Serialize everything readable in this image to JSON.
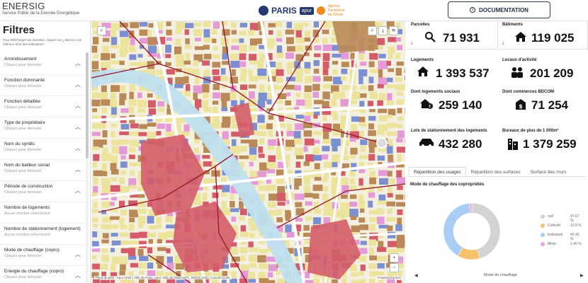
{
  "header": {
    "title": "ENERSIG",
    "subtitle": "Service Public de la Donnée Energétique",
    "paris_logo": "PARIS",
    "apur_logo": "apur",
    "agence_logo": "Agence Parisienne du Climat",
    "doc_button": "DOCUMENTATION",
    "doc_icon": "info-icon"
  },
  "sidebar": {
    "title": "Filtres",
    "help_text": "Pour télécharger les données, cliquez sur ⤓ dans le coin inférieur droit des indicateurs",
    "items": [
      {
        "label": "Arrondissement",
        "hint": "Cliquez pour dérouler"
      },
      {
        "label": "Fonction dominante",
        "hint": "Cliquez pour dérouler"
      },
      {
        "label": "Fonction détaillée",
        "hint": "Cliquez pour dérouler"
      },
      {
        "label": "Type de propriétaire",
        "hint": "Cliquez pour dérouler"
      },
      {
        "label": "Nom du syndic",
        "hint": "Cliquez pour dérouler"
      },
      {
        "label": "Nom du bailleur social",
        "hint": "Cliquez pour dérouler"
      },
      {
        "label": "Période de construction",
        "hint": "Cliquez pour dérouler"
      },
      {
        "label": "Nombre de logements",
        "hint": "Aucun nombre sélectionné"
      },
      {
        "label": "Nombre de stationnement (logement)",
        "hint": "Aucun nombre sélectionné"
      },
      {
        "label": "Mode de chauffage (copro)",
        "hint": "Cliquez pour dérouler"
      },
      {
        "label": "Energie du chauffage (copro)",
        "hint": "Cliquez pour dérouler"
      }
    ]
  },
  "map": {
    "credit_left": "Fond de plan : Apur 2018 | Ville de Paris, Apur, Ville de Paris, APC, DGFIP, ENC, CouchCounts",
    "credit_right": "Powered by Esri",
    "colors": {
      "base": "#f4f0df",
      "residential": "#ece39c",
      "office": "#b98a57",
      "public": "#d45c6a",
      "water": "#bfe0ef",
      "road": "#ffffff",
      "boundary": "#9b1c33",
      "blue": "#7b8fd1",
      "pink": "#e59ad8"
    }
  },
  "kpis": {
    "parcelles": {
      "label": "Parcelles",
      "value": "71 931",
      "icon": "search-icon"
    },
    "batiments": {
      "label": "Bâtiments",
      "value": "119 025",
      "icon": "house-icon"
    },
    "logements": {
      "label": "Logements",
      "value": "1 393 537",
      "icon": "home-icon"
    },
    "locaux": {
      "label": "Locaux d'activité",
      "value": "201 209",
      "icon": "people-icon"
    },
    "sociaux": {
      "label": "Dont logements sociaux",
      "value": "259 140",
      "icon": "social-housing-icon"
    },
    "commerces": {
      "label": "Dont commerces BDCOM",
      "value": "71 254",
      "icon": "shop-icon"
    },
    "stationnement": {
      "label": "Lots de stationnement des logements",
      "value": "432 280",
      "icon": "car-icon"
    },
    "bureaux": {
      "label": "Bureaux de plus de 1 000m²",
      "value": "1 379 259",
      "icon": "office-building-icon"
    }
  },
  "tabs": [
    {
      "label": "Répartition des usages",
      "active": true
    },
    {
      "label": "Répartition des surfaces",
      "active": false
    },
    {
      "label": "Surface des murs",
      "active": false
    }
  ],
  "chart_data": {
    "type": "pie",
    "title": "Mode de chauffage des copropriétés",
    "xlabel": "Mode de chauffage",
    "categories": [
      "null",
      "Collectif",
      "Individuel",
      "Mixte"
    ],
    "values": [
      47.67,
      13.5,
      42.43,
      1.46
    ],
    "value_labels": [
      "47.67 %",
      "13.5 %",
      "42.43 %",
      "1.46 %"
    ],
    "colors": [
      "#d3d3d3",
      "#f6c26b",
      "#a9cdf5",
      "#e9a8e0"
    ],
    "legend": "right"
  },
  "chart_nav": {
    "prev": "◀",
    "next": "▶"
  }
}
